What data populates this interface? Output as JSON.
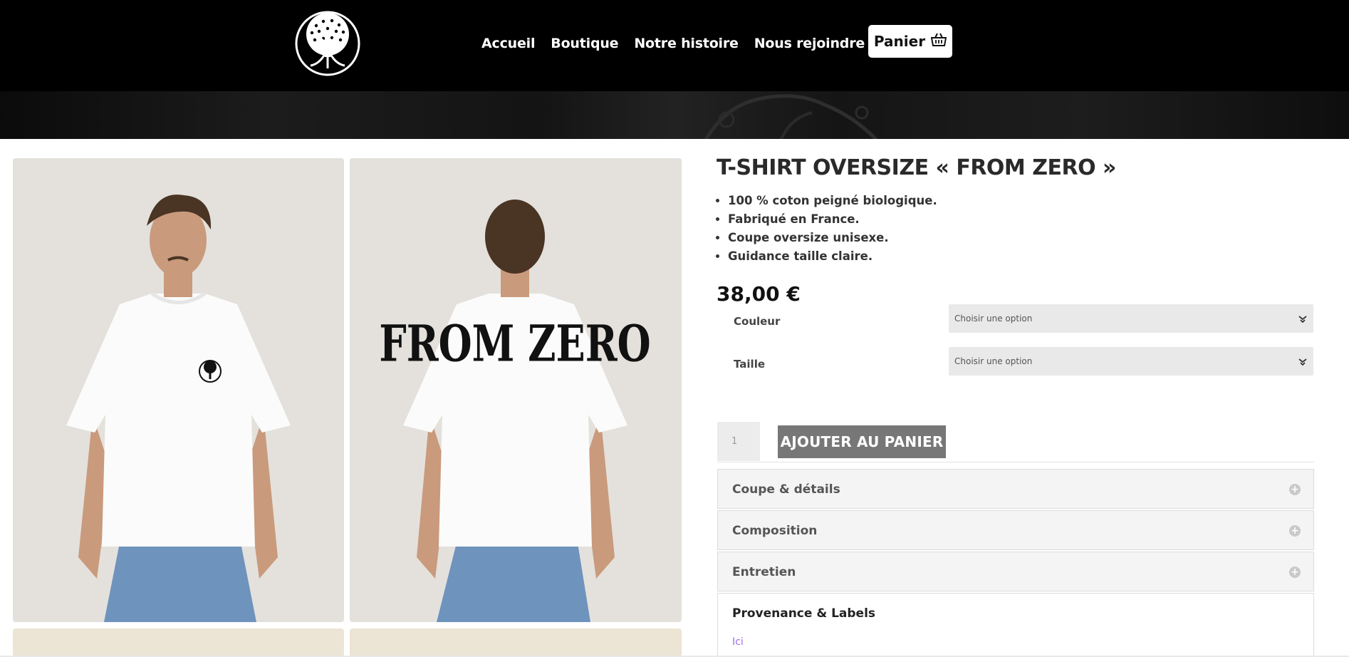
{
  "header": {
    "nav": [
      "Accueil",
      "Boutique",
      "Notre histoire",
      "Nous rejoindre"
    ],
    "cart_label": "Panier"
  },
  "gallery": {
    "back_print_text": "FROM ZERO"
  },
  "product": {
    "title": "T-SHIRT OVERSIZE « FROM ZERO »",
    "features": [
      "100 % coton peigné biologique.",
      "Fabriqué en France.",
      "Coupe oversize unisexe.",
      "Guidance taille claire."
    ],
    "price": "38,00 €",
    "variations": [
      {
        "label": "Couleur",
        "value": "Choisir une option"
      },
      {
        "label": "Taille",
        "value": "Choisir une option"
      }
    ],
    "quantity": "1",
    "add_to_cart_label": "AJOUTER AU PANIER"
  },
  "accordion": {
    "items": [
      "Coupe & détails",
      "Composition",
      "Entretien"
    ],
    "open_item": {
      "title": "Provenance & Labels",
      "link": "Ici"
    }
  },
  "colors": {
    "header_bg": "#000000",
    "button_grey": "#777777",
    "link_purple": "#a46ce0"
  }
}
